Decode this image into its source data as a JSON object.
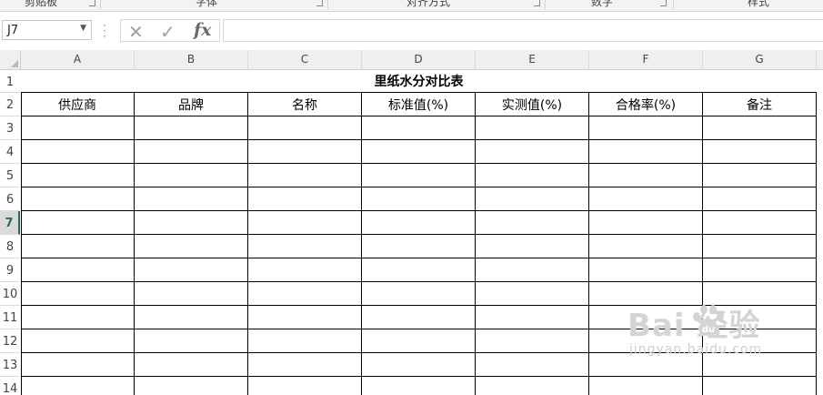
{
  "ribbon": {
    "groups": [
      "剪贴板",
      "字体",
      "对齐方式",
      "数字",
      "样式"
    ]
  },
  "formula_bar": {
    "name_box_value": "J7",
    "formula_value": ""
  },
  "columns": [
    "A",
    "B",
    "C",
    "D",
    "E",
    "F",
    "G"
  ],
  "rows": [
    "1",
    "2",
    "3",
    "4",
    "5",
    "6",
    "7",
    "8",
    "9",
    "10",
    "11",
    "12",
    "13",
    "14"
  ],
  "active_row": "7",
  "sheet": {
    "title": "里纸水分对比表",
    "headers": [
      "供应商",
      "品牌",
      "名称",
      "标准值(%)",
      "实测值(%)",
      "合格率(%)",
      "备注"
    ]
  },
  "watermark": {
    "logo_text": "Bai  经验",
    "url": "jingyan.baidu.com"
  },
  "colors": {
    "accent": "#217346",
    "header_bg": "#efefef"
  }
}
